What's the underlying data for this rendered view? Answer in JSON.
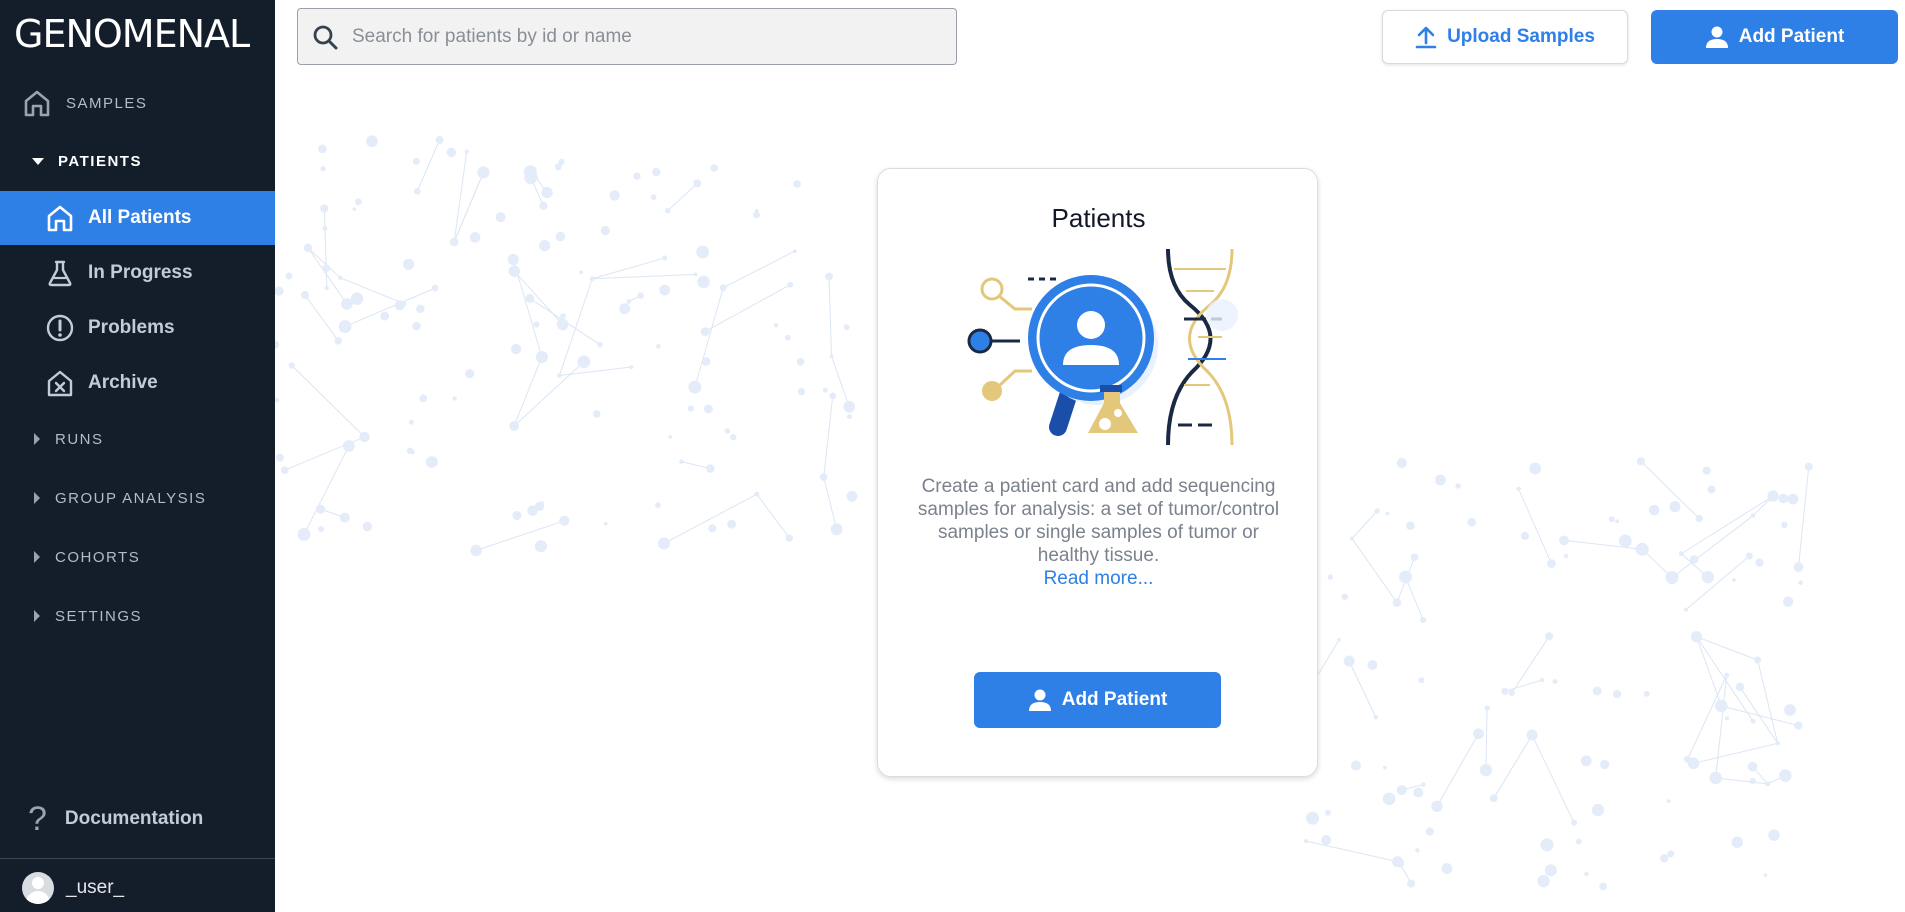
{
  "app": {
    "logo": "GENOMENAL"
  },
  "sidebar": {
    "sections": [
      {
        "id": "samples",
        "label": "SAMPLES",
        "icon": "home-icon"
      },
      {
        "id": "patients",
        "label": "PATIENTS",
        "expanded": true
      },
      {
        "id": "runs",
        "label": "RUNS",
        "expanded": false
      },
      {
        "id": "group_analysis",
        "label": "GROUP ANALYSIS",
        "expanded": false
      },
      {
        "id": "cohorts",
        "label": "COHORTS",
        "expanded": false
      },
      {
        "id": "settings",
        "label": "SETTINGS",
        "expanded": false
      }
    ],
    "patients_items": [
      {
        "label": "All Patients",
        "icon": "home-icon",
        "active": true
      },
      {
        "label": "In Progress",
        "icon": "flask-icon",
        "active": false
      },
      {
        "label": "Problems",
        "icon": "exclamation-icon",
        "active": false
      },
      {
        "label": "Archive",
        "icon": "archive-icon",
        "active": false
      }
    ],
    "documentation": "Documentation",
    "user": "_user_"
  },
  "topbar": {
    "search_placeholder": "Search for patients by id or name",
    "upload_label": "Upload Samples",
    "add_patient_label": "Add Patient"
  },
  "card": {
    "title": "Patients",
    "description": "Create a patient card and add sequencing samples for analysis: a set of tumor/control samples or single samples of tumor or healthy tissue.",
    "read_more": "Read more...",
    "button_label": "Add Patient"
  },
  "colors": {
    "sidebar_bg": "#141e2b",
    "accent": "#2e7fe6",
    "illustration_gold": "#e3c77a",
    "illustration_navy": "#1b2a44"
  }
}
